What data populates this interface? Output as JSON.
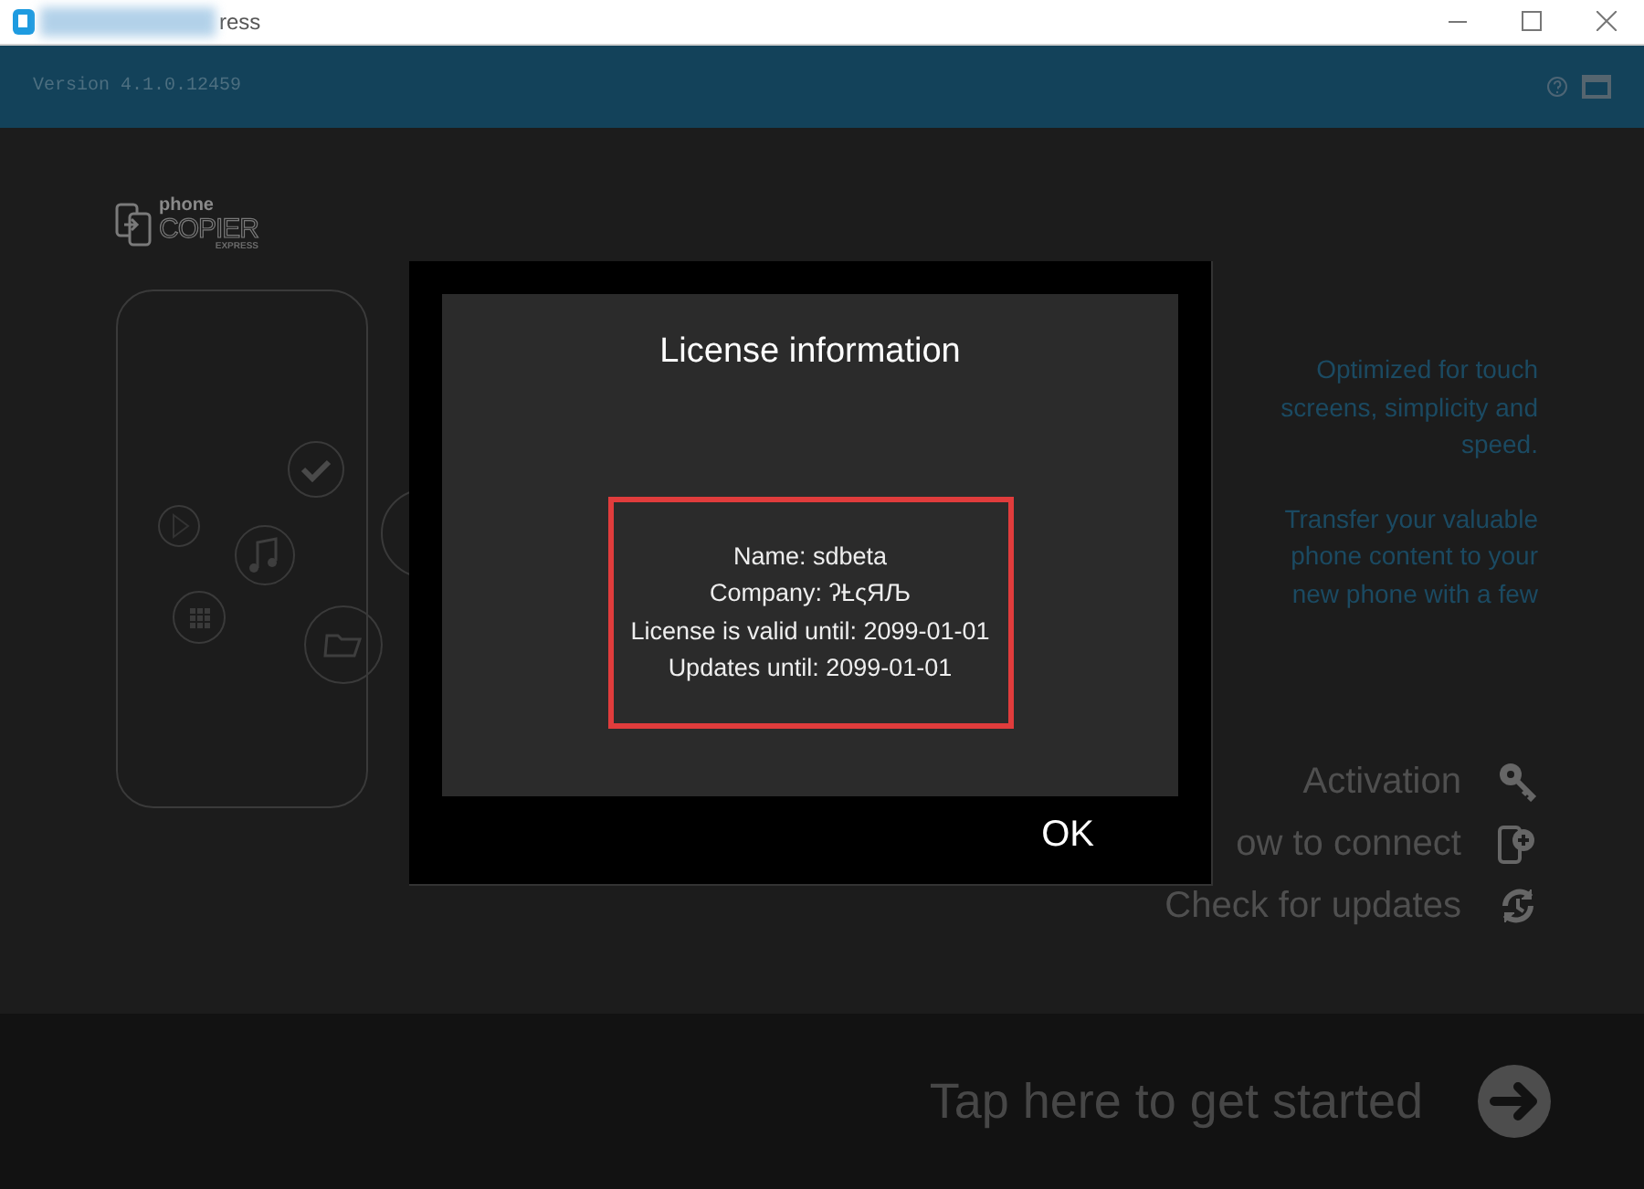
{
  "window": {
    "title": "ress",
    "version": "Version 4.1.0.12459"
  },
  "logo": {
    "top": "phone",
    "main": "COPIER",
    "sub": "EXPRESS"
  },
  "promo": [
    {
      "lines": [
        "Optimized for touch",
        "screens, simplicity and",
        "speed."
      ]
    },
    {
      "lines": [
        "Transfer your valuable",
        "phone content to your",
        "new phone with a few"
      ]
    }
  ],
  "menu": [
    {
      "label": "Activation"
    },
    {
      "label": "ow to connect"
    },
    {
      "label": "Check for updates"
    }
  ],
  "start": {
    "label": "Tap here to get started"
  },
  "dialog": {
    "title": "License information",
    "lines": [
      "Name: sdbeta",
      "Company: ʔȽςЯЉ",
      "License is valid until: 2099-01-01",
      "Updates until: 2099-01-01"
    ],
    "button": "OK"
  }
}
